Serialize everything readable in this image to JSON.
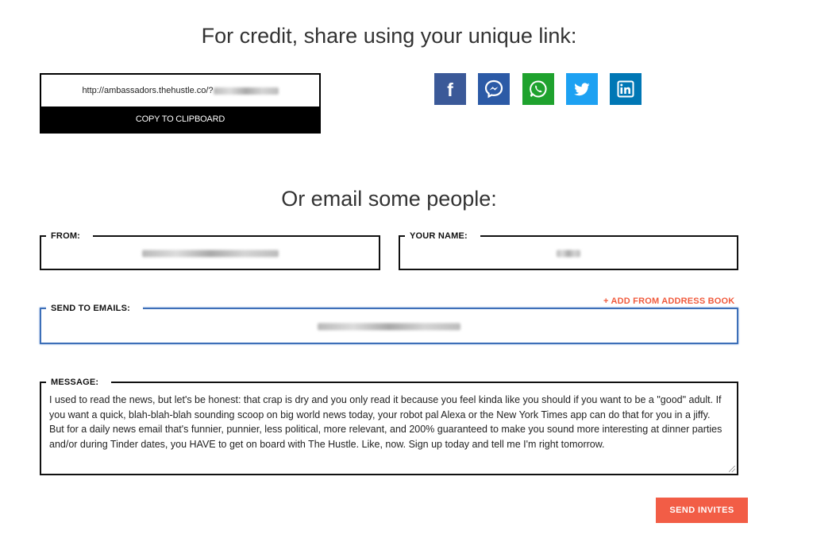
{
  "share": {
    "heading": "For credit, share using your unique link:",
    "link_prefix": "http://ambassadors.thehustle.co/?",
    "copy_label": "COPY TO CLIPBOARD",
    "buttons": [
      {
        "name": "facebook",
        "icon": "facebook-icon",
        "color": "#3b5998"
      },
      {
        "name": "messenger",
        "icon": "messenger-icon",
        "color": "#2c5aa6"
      },
      {
        "name": "whatsapp",
        "icon": "whatsapp-icon",
        "color": "#1fa22e"
      },
      {
        "name": "twitter",
        "icon": "twitter-icon",
        "color": "#1da1f2"
      },
      {
        "name": "linkedin",
        "icon": "linkedin-icon",
        "color": "#0077b5"
      }
    ]
  },
  "email": {
    "heading": "Or email some people:",
    "from_label": "FROM:",
    "your_name_label": "YOUR NAME:",
    "send_to_label": "SEND TO EMAILS:",
    "add_from_book": "+ ADD FROM ADDRESS BOOK",
    "message_label": "MESSAGE:",
    "message": "I used to read the news, but let's be honest: that crap is dry and you only read it because you feel kinda like you should if you want to be a \"good\" adult. If you want a quick, blah-blah-blah sounding scoop on big world news today, your robot pal Alexa or the New York Times app can do that for you in a jiffy. But for a daily news email that's funnier, punnier, less political, more relevant, and 200% guaranteed to make you sound more interesting at dinner parties and/or during Tinder dates, you HAVE to get on board with The Hustle. Like, now. Sign up today and tell me I'm right tomorrow.",
    "send_label": "SEND INVITES"
  },
  "colors": {
    "accent": "#f25d46",
    "focus_border": "#3d6fb8"
  }
}
